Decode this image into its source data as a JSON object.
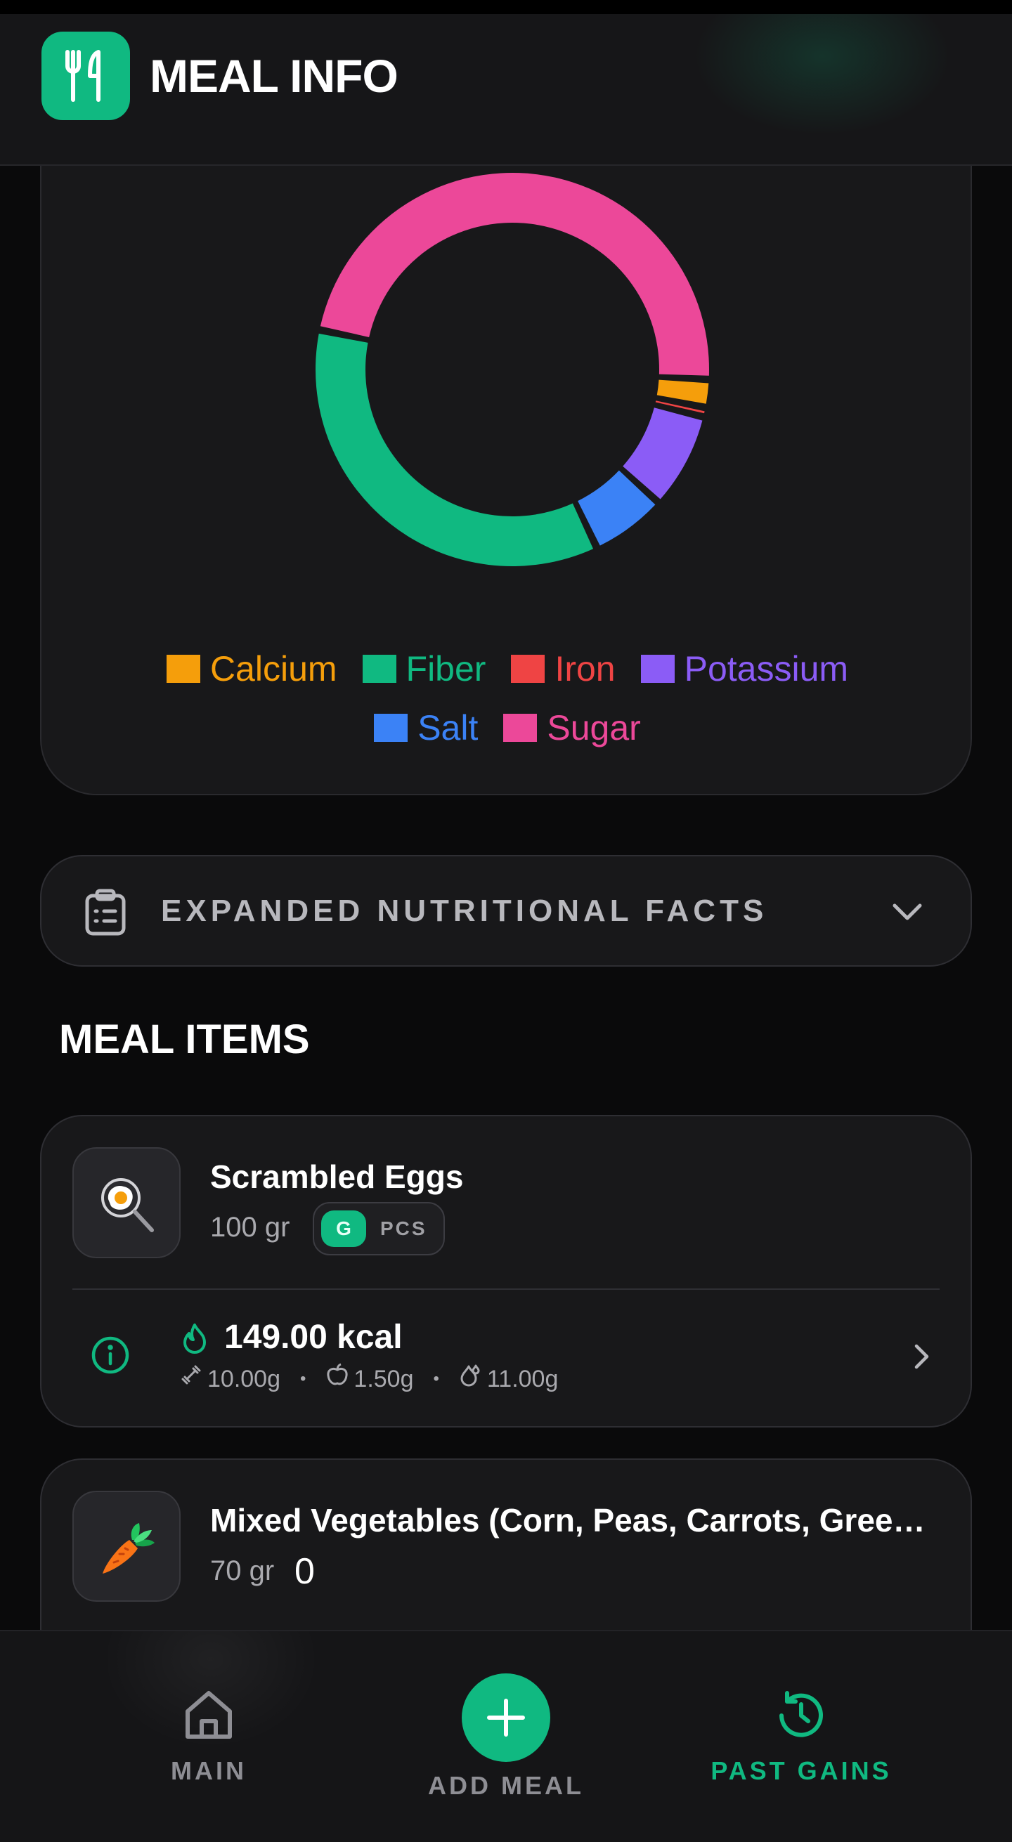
{
  "header": {
    "title": "MEAL INFO",
    "logo_icon": "fork-knife-icon"
  },
  "colors": {
    "accent": "#10b981",
    "calcium": "#f59e0b",
    "fiber": "#10b981",
    "iron": "#ef4444",
    "potassium": "#8b5cf6",
    "salt": "#3b82f6",
    "sugar": "#ec4899"
  },
  "chart_data": {
    "type": "pie",
    "style": "donut",
    "legend_position": "bottom",
    "series": [
      {
        "name": "Calcium",
        "value": 1.5,
        "color": "#f59e0b"
      },
      {
        "name": "Fiber",
        "value": 31,
        "color": "#10b981"
      },
      {
        "name": "Iron",
        "value": 0.15,
        "color": "#ef4444"
      },
      {
        "name": "Potassium",
        "value": 6.5,
        "color": "#8b5cf6"
      },
      {
        "name": "Salt",
        "value": 5,
        "color": "#3b82f6"
      },
      {
        "name": "Sugar",
        "value": 42,
        "color": "#ec4899"
      }
    ]
  },
  "legend": {
    "row1": [
      "Calcium",
      "Fiber",
      "Iron",
      "Potassium"
    ],
    "row2": [
      "Salt",
      "Sugar"
    ]
  },
  "facts": {
    "label": "EXPANDED NUTRITIONAL FACTS",
    "icon": "clipboard-list-icon",
    "chevron": "chevron-down-icon"
  },
  "meal_items": {
    "title": "MEAL ITEMS",
    "items": [
      {
        "name": "Scrambled Eggs",
        "icon": "fried-egg-icon",
        "amount": "100 gr",
        "unit_toggle": {
          "selected": "G",
          "other": "PCS"
        },
        "kcal": "149.00 kcal",
        "protein": "10.00g",
        "carbs": "1.50g",
        "fat": "11.00g"
      },
      {
        "name": "Mixed Vegetables (Corn, Peas, Carrots, Green…",
        "icon": "carrot-icon",
        "amount": "70 gr",
        "quantity": "0"
      }
    ]
  },
  "nav": {
    "main": "MAIN",
    "add_meal": "ADD MEAL",
    "past_gains": "PAST GAINS",
    "active": "past_gains"
  }
}
